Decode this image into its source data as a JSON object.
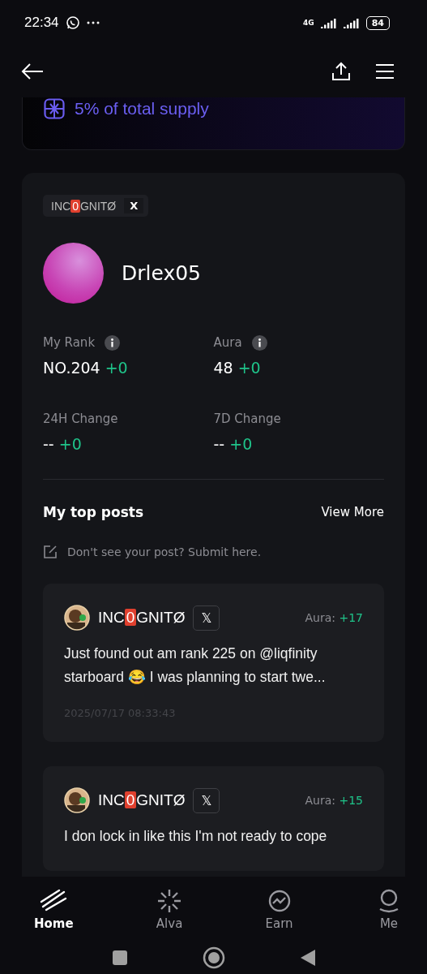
{
  "status_bar": {
    "time": "22:34",
    "network": "4G",
    "battery": "84"
  },
  "banner": {
    "text": "5% of total supply"
  },
  "profile": {
    "tag": {
      "name_parts": [
        {
          "kind": "plain",
          "text": "INC"
        },
        {
          "kind": "boxed",
          "text": "0"
        },
        {
          "kind": "plain",
          "text": "GNITØ"
        }
      ],
      "platform": "X"
    },
    "username": "Drlex05",
    "stats": [
      {
        "label": "My Rank",
        "info": true,
        "value": "NO.204",
        "change": "+0"
      },
      {
        "label": "Aura",
        "info": true,
        "value": "48",
        "change": "+0"
      },
      {
        "label": "24H Change",
        "info": false,
        "value": "--",
        "change": "+0"
      },
      {
        "label": "7D Change",
        "info": false,
        "value": "--",
        "change": "+0"
      }
    ]
  },
  "top_posts": {
    "title": "My top posts",
    "view_more": "View More",
    "submit_hint": "Don't see your post? Submit here.",
    "posts": [
      {
        "author_parts": [
          {
            "kind": "plain",
            "text": "INC"
          },
          {
            "kind": "boxed",
            "text": "0"
          },
          {
            "kind": "plain",
            "text": "GNITØ"
          }
        ],
        "platform": "𝕏",
        "aura_label": "Aura:",
        "aura": "+17",
        "text": "Just found out am rank 225 on @liqfinity starboard 😂 I was planning to start twe...",
        "time": "2025/07/17 08:33:43"
      },
      {
        "author_parts": [
          {
            "kind": "plain",
            "text": "INC"
          },
          {
            "kind": "boxed",
            "text": "0"
          },
          {
            "kind": "plain",
            "text": "GNITØ"
          }
        ],
        "platform": "𝕏",
        "aura_label": "Aura:",
        "aura": "+15",
        "text": "I don lock in like this I'm not ready to cope"
      }
    ]
  },
  "bottom_nav": [
    {
      "label": "Home",
      "selected": true
    },
    {
      "label": "Alva",
      "selected": false
    },
    {
      "label": "Earn",
      "selected": false
    },
    {
      "label": "Me",
      "selected": false
    }
  ]
}
